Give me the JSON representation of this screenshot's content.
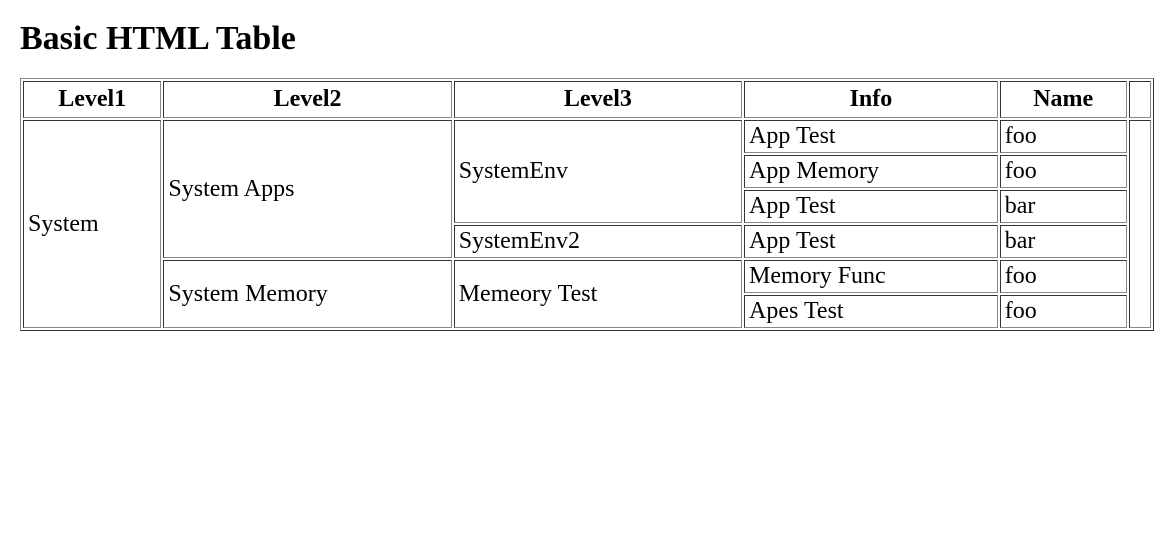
{
  "heading": "Basic HTML Table",
  "headers": {
    "level1": "Level1",
    "level2": "Level2",
    "level3": "Level3",
    "info": "Info",
    "name": "Name"
  },
  "rows": [
    {
      "level1": "System",
      "level2": "System Apps",
      "level3": "SystemEnv",
      "info": "App Test",
      "name": "foo"
    },
    {
      "level1": "System",
      "level2": "System Apps",
      "level3": "SystemEnv",
      "info": "App Memory",
      "name": "foo"
    },
    {
      "level1": "System",
      "level2": "System Apps",
      "level3": "SystemEnv",
      "info": "App Test",
      "name": "bar"
    },
    {
      "level1": "System",
      "level2": "System Apps",
      "level3": "SystemEnv2",
      "info": "App Test",
      "name": "bar"
    },
    {
      "level1": "System",
      "level2": "System Memory",
      "level3": "Memeory Test",
      "info": "Memory Func",
      "name": "foo"
    },
    {
      "level1": "System",
      "level2": "System Memory",
      "level3": "Memeory Test",
      "info": "Apes Test",
      "name": "foo"
    }
  ]
}
